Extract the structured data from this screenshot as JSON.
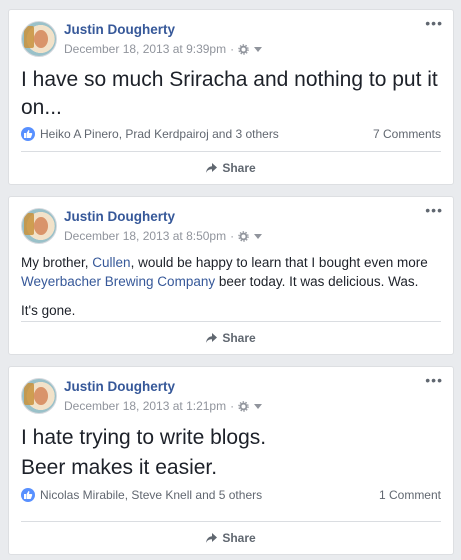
{
  "posts": [
    {
      "author": "Justin Dougherty",
      "timestamp": "December 18, 2013 at 9:39pm",
      "lines": [
        "I have so much Sriracha and nothing to put it on..."
      ],
      "reactions": "Heiko A Pinero, Prad Kerdpairoj and 3 others",
      "comments": "7 Comments",
      "share_label": "Share"
    },
    {
      "author": "Justin Dougherty",
      "timestamp": "December 18, 2013 at 8:50pm",
      "para1_a": "My brother, ",
      "para1_link1": "Cullen",
      "para1_b": ", would be happy to learn that I bought even more ",
      "para1_link2": "Weyerbacher Brewing Company",
      "para1_c": " beer today. It was delicious. Was.",
      "para2": "It's gone.",
      "share_label": "Share"
    },
    {
      "author": "Justin Dougherty",
      "timestamp": "December 18, 2013 at 1:21pm",
      "lines": [
        "I hate trying to write blogs.",
        "Beer makes it easier."
      ],
      "reactions": "Nicolas Mirabile, Steve Knell and 5 others",
      "comments": "1 Comment",
      "share_label": "Share"
    }
  ],
  "colors": {
    "link": "#365899",
    "meta": "#90949c",
    "like": "#5890ff",
    "page_bg": "#e9ebee"
  },
  "icons": {
    "audience": "gear-icon",
    "menu": "more-options-icon",
    "share": "share-arrow-icon",
    "reaction": "like-icon"
  }
}
